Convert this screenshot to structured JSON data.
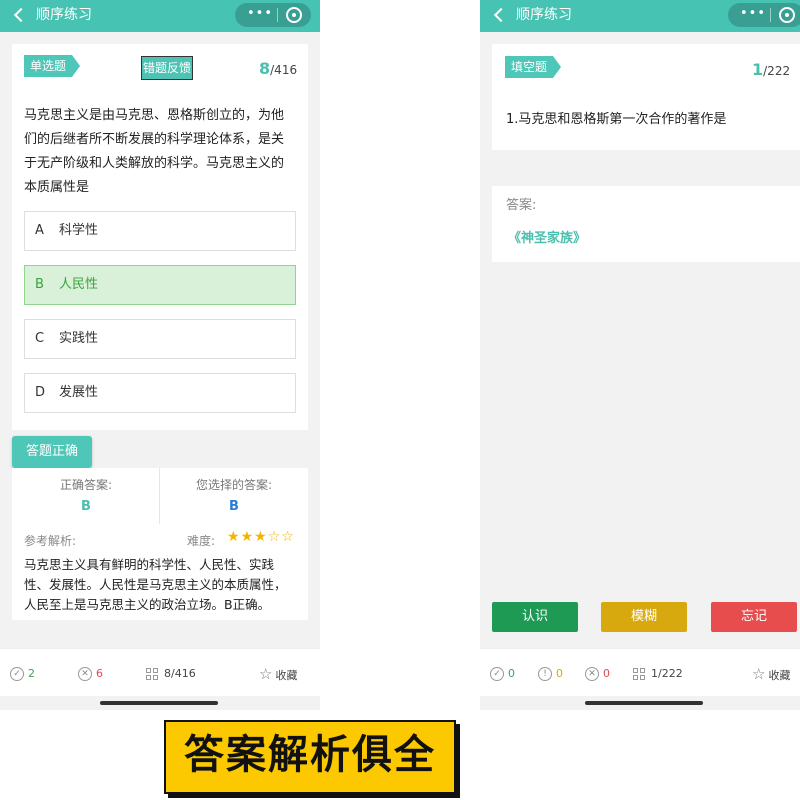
{
  "left": {
    "title": "顺序练习",
    "capsule_dots": "•••",
    "question_type": "单选题",
    "feedback_label": "错题反馈",
    "count_current": "8",
    "count_total": "/416",
    "question_lines": [
      "马克思主义是由马克思、恩格斯创立的，为他",
      "们的后继者所不断发展的科学理论体系，是关",
      "于无产阶级和人类解放的科学。马克思主义的",
      "本质属性是"
    ],
    "options": [
      {
        "letter": "A",
        "text": "科学性"
      },
      {
        "letter": "B",
        "text": "人民性"
      },
      {
        "letter": "C",
        "text": "实践性"
      },
      {
        "letter": "D",
        "text": "发展性"
      }
    ],
    "selected_index": 1,
    "result_label": "答题正确",
    "correct_answer_label": "正确答案:",
    "correct_answer": "B",
    "your_answer_label": "您选择的答案:",
    "your_answer": "B",
    "analysis_label": "参考解析:",
    "difficulty_label": "难度:",
    "difficulty_stars": 3,
    "difficulty_max": 5,
    "analysis_lines": [
      "马克思主义具有鲜明的科学性、人民性、实践",
      "性、发展性。人民性是马克思主义的本质属性，",
      "人民至上是马克思主义的政治立场。B正确。"
    ],
    "bottom": {
      "correct_count": "2",
      "wrong_count": "6",
      "progress": "8/416",
      "favorite": "收藏"
    }
  },
  "right": {
    "title": "顺序练习",
    "capsule_dots": "•••",
    "question_type": "填空题",
    "count_current": "1",
    "count_total": "/222",
    "question": "1.马克思和恩格斯第一次合作的著作是",
    "answer_label": "答案:",
    "answer": "《神圣家族》",
    "buttons": [
      {
        "label": "认识",
        "color": "#1f9a55"
      },
      {
        "label": "模糊",
        "color": "#d8a90e"
      },
      {
        "label": "忘记",
        "color": "#e84d4d"
      }
    ],
    "bottom": {
      "check_count": "0",
      "unsure_count": "0",
      "wrong_count": "0",
      "progress": "1/222",
      "favorite": "收藏"
    }
  },
  "banner": "答案解析俱全",
  "colors": {
    "accent": "#47c3b4",
    "selected_bg": "#d9f0d9",
    "answer_teal": "#4bbfae",
    "answer_blue": "#2a7fd4",
    "star": "#f5b400",
    "banner_bg": "#fcc900"
  }
}
